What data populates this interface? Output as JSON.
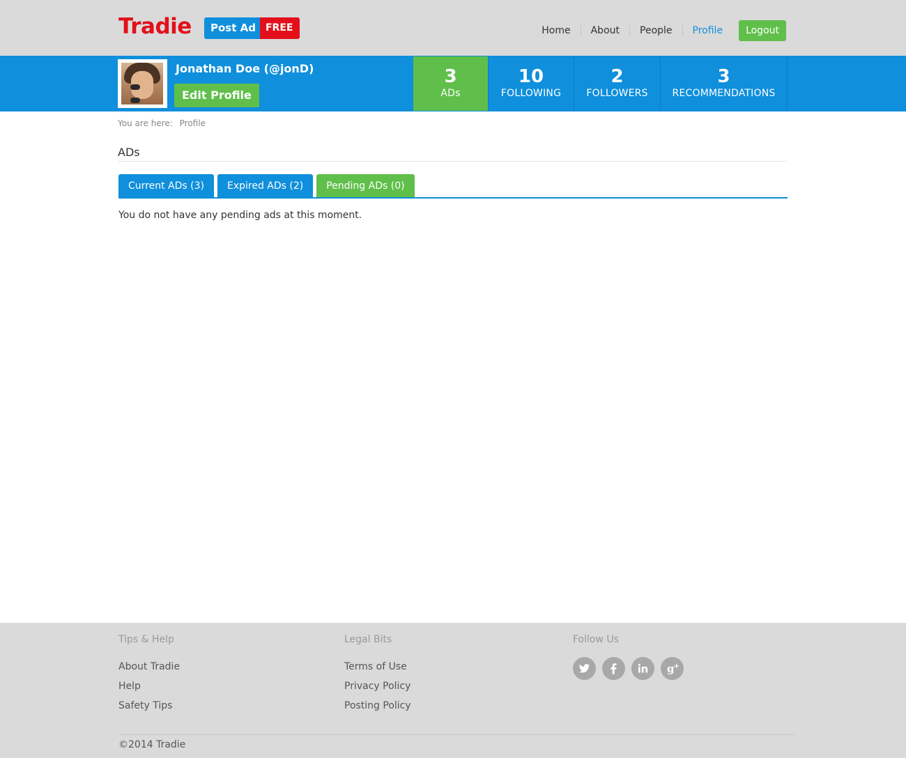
{
  "header": {
    "logo": "Tradie",
    "post_ad": "Post Ad",
    "free": "FREE",
    "nav": [
      "Home",
      "About",
      "People",
      "Profile"
    ],
    "logout": "Logout"
  },
  "profile": {
    "name": "Jonathan Doe (@jonD)",
    "edit": "Edit Profile",
    "stats": [
      {
        "num": "3",
        "label": "ADs"
      },
      {
        "num": "10",
        "label": "FOLLOWING"
      },
      {
        "num": "2",
        "label": "FOLLOWERS"
      },
      {
        "num": "3",
        "label": "RECOMMENDATIONS"
      }
    ]
  },
  "breadcrumb": {
    "prefix": "You are here:",
    "current": "Profile"
  },
  "section": {
    "title": "ADs"
  },
  "tabs": [
    "Current ADs (3)",
    "Expired ADs (2)",
    "Pending ADs (0)"
  ],
  "message": "You do not have any pending ads at this moment.",
  "footer": {
    "tips": {
      "title": "Tips & Help",
      "links": [
        "About Tradie",
        "Help",
        "Safety Tips"
      ]
    },
    "legal": {
      "title": "Legal Bits",
      "links": [
        "Terms of Use",
        "Privacy Policy",
        "Posting Policy"
      ]
    },
    "follow": {
      "title": "Follow Us",
      "icons": [
        "twitter-icon",
        "facebook-icon",
        "linkedin-icon",
        "googleplus-icon"
      ]
    },
    "copyright": "©2014 Tradie"
  },
  "colors": {
    "blue": "#0f8fdc",
    "green": "#5fbf4a",
    "red": "#e3101b",
    "grey": "#dadada"
  }
}
